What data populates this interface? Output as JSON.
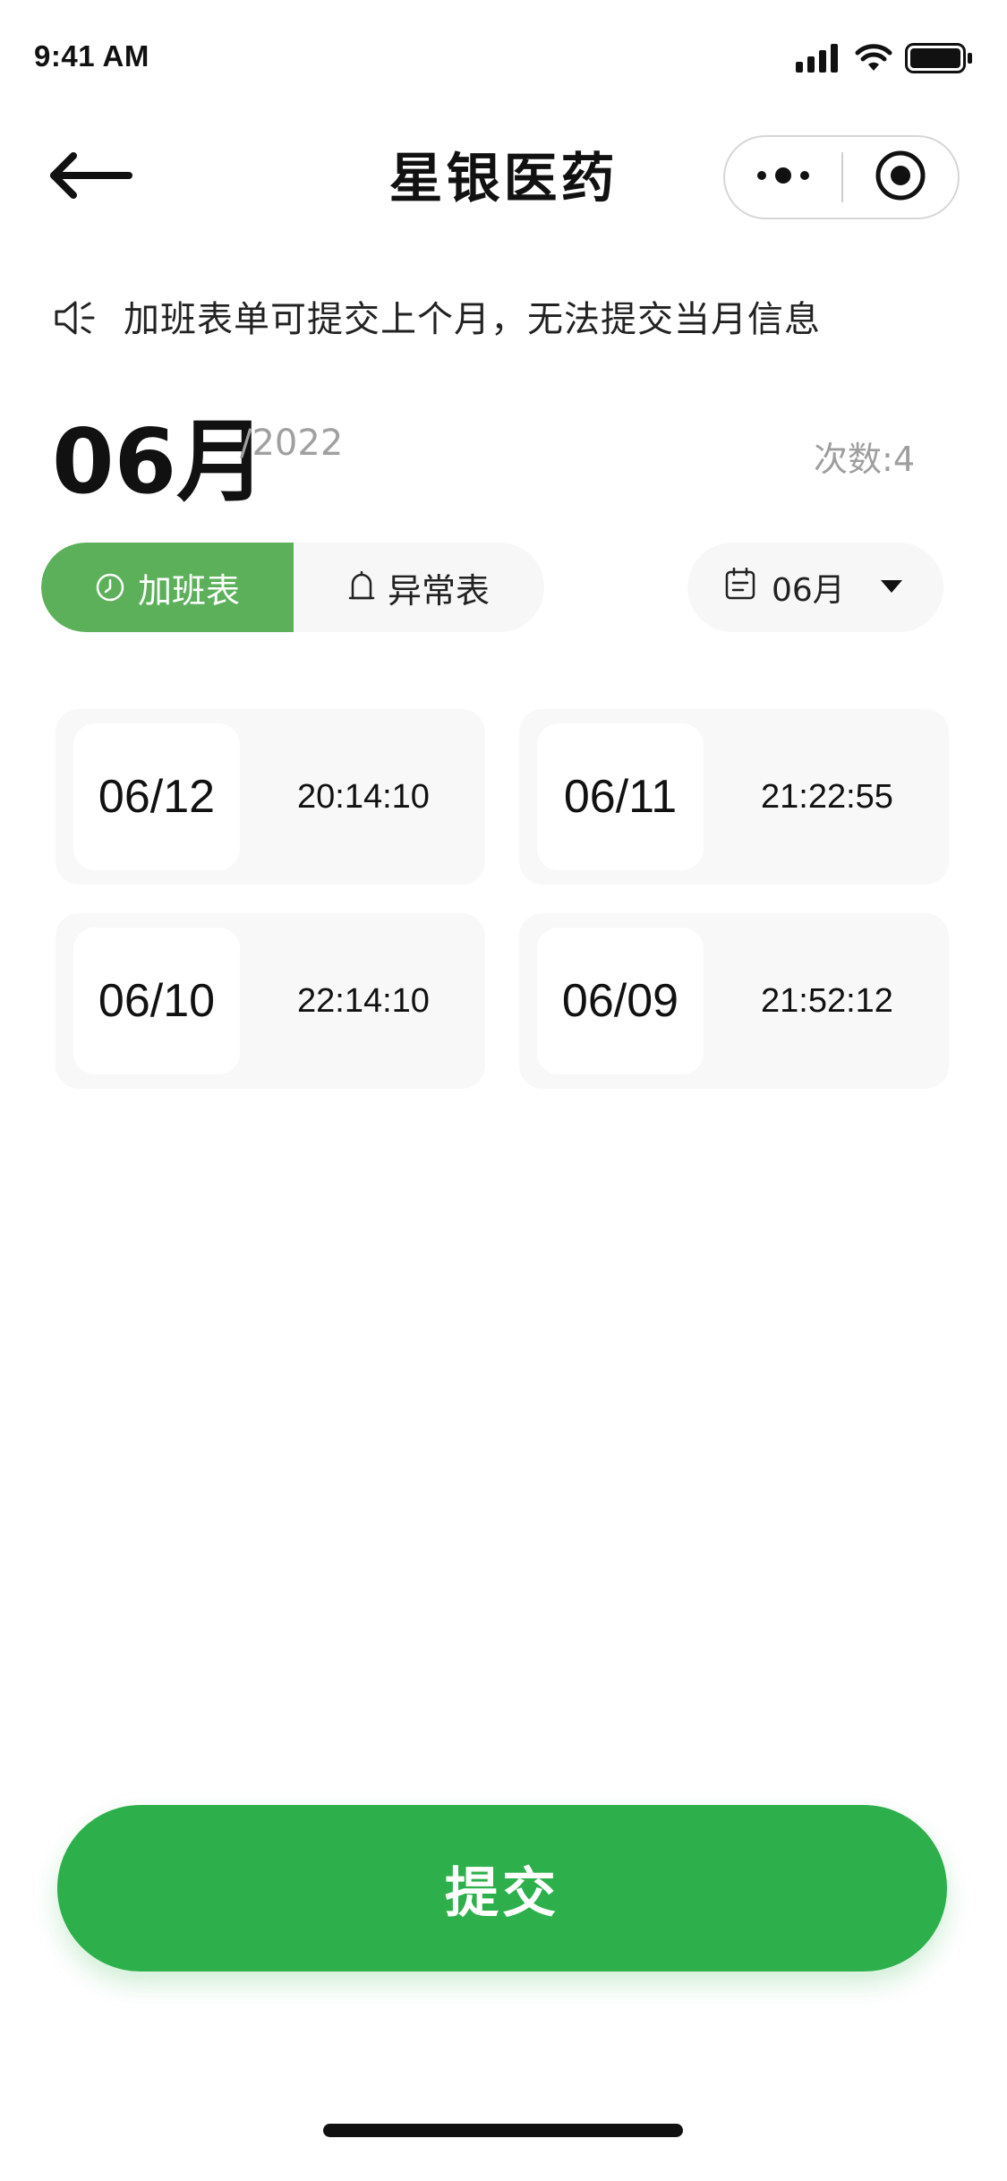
{
  "status_bar": {
    "time": "9:41 AM"
  },
  "nav": {
    "title": "星银医药"
  },
  "notice": {
    "text": "加班表单可提交上个月，无法提交当月信息"
  },
  "month_header": {
    "month": "06月",
    "year": "/2022",
    "count": "次数:4"
  },
  "tabs": [
    {
      "label": "加班表",
      "icon": "clock-icon",
      "active": true
    },
    {
      "label": "异常表",
      "icon": "bell-icon",
      "active": false
    }
  ],
  "month_select": {
    "label": "06月",
    "icon": "calendar-icon"
  },
  "records": [
    {
      "date": "06/12",
      "time": "20:14:10"
    },
    {
      "date": "06/11",
      "time": "21:22:55"
    },
    {
      "date": "06/10",
      "time": "22:14:10"
    },
    {
      "date": "06/09",
      "time": "21:52:12"
    }
  ],
  "submit": {
    "label": "提交"
  },
  "colors": {
    "accent_tab": "#5cb05a",
    "submit_green": "#2db04b",
    "muted_text": "#a0a0a0",
    "card_bg": "#f8f8f8"
  }
}
